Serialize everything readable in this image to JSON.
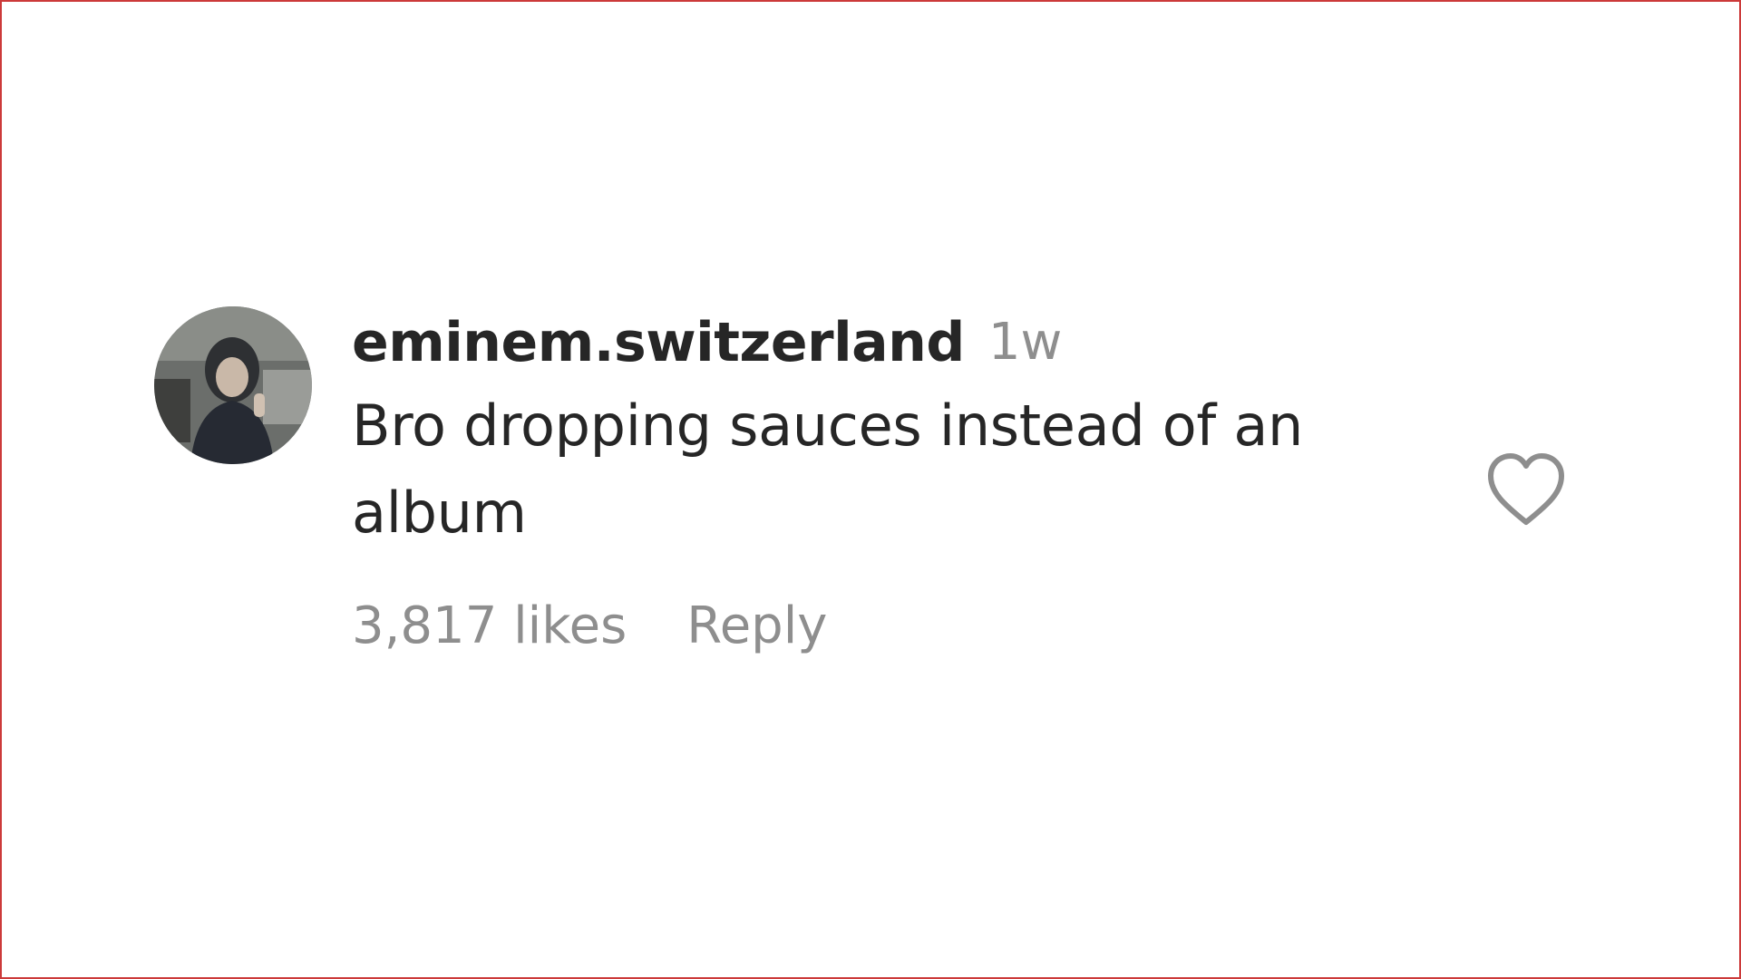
{
  "comment": {
    "username": "eminem.switzerland",
    "time": "1w",
    "text": "Bro dropping sauces instead of an album",
    "likes": "3,817 likes",
    "reply_label": "Reply",
    "avatar_icon": "user-avatar-photo",
    "like_icon": "heart-outline-icon"
  },
  "colors": {
    "frame_border": "#cc3a3a",
    "text_primary": "#262626",
    "text_secondary": "#8e8e8e"
  }
}
